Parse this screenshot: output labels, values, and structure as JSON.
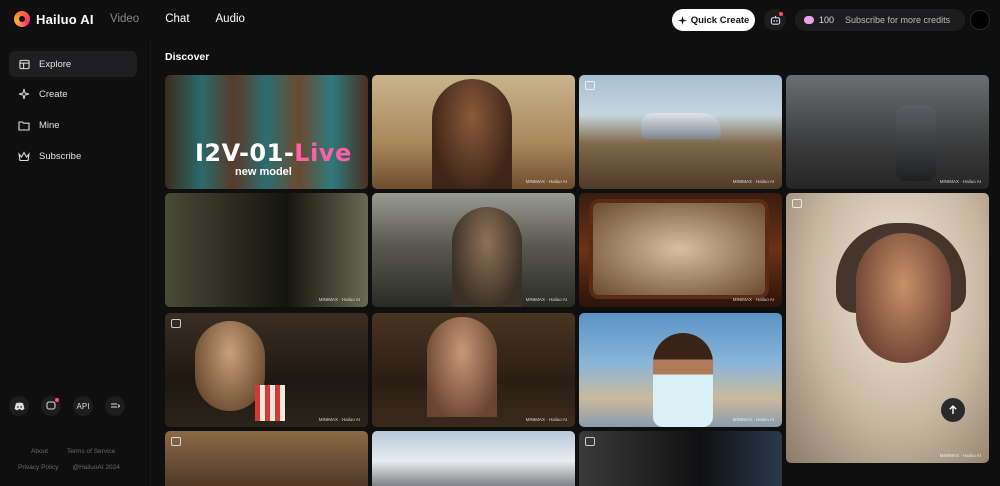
{
  "app": {
    "brand": "Hailuo AI",
    "nav": [
      {
        "label": "Video",
        "active": false
      },
      {
        "label": "Chat",
        "active": true
      },
      {
        "label": "Audio",
        "active": true
      }
    ]
  },
  "header": {
    "quick_create_label": "Quick Create",
    "credits_count": "100",
    "subscribe_label": "Subscribe for more credits"
  },
  "sidebar": {
    "items": [
      {
        "label": "Explore",
        "icon": "explore-icon",
        "active": true
      },
      {
        "label": "Create",
        "icon": "sparkle-icon",
        "active": false
      },
      {
        "label": "Mine",
        "icon": "folder-icon",
        "active": false
      },
      {
        "label": "Subscribe",
        "icon": "crown-icon",
        "active": false
      }
    ],
    "api_label": "API",
    "footer": {
      "about": "About",
      "terms": "Terms of Service",
      "privacy": "Privacy Policy",
      "copyright": "@HailuoAI 2024"
    }
  },
  "main": {
    "section_title": "Discover",
    "featured": {
      "title_part1": "I2V-01-",
      "title_part2": "Live",
      "subtitle": "new model"
    },
    "watermark": "MINIMAX · Hailuo AI"
  },
  "colors": {
    "background": "#0f0f10",
    "accent_pink": "#ff5fa8",
    "button_white": "#ffffff"
  }
}
